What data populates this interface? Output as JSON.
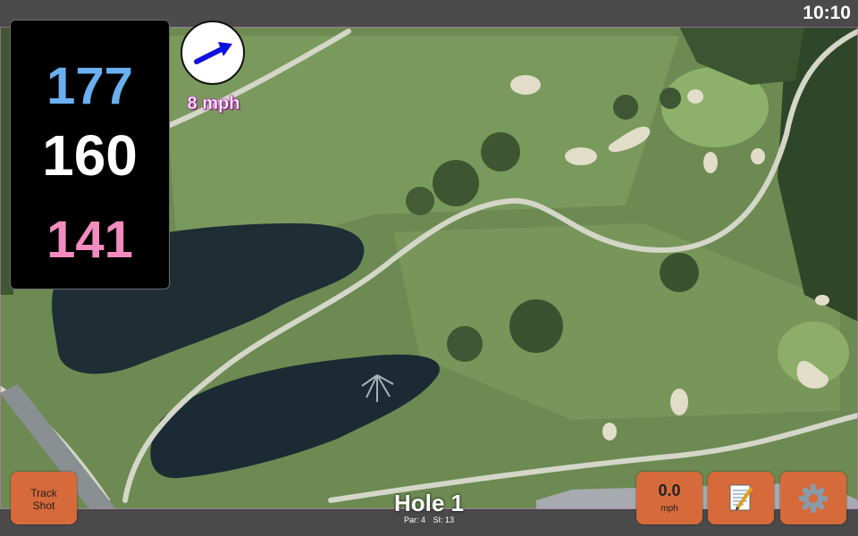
{
  "status": {
    "time": "10:10"
  },
  "distances": {
    "back": "177",
    "middle": "160",
    "front": "141"
  },
  "wind": {
    "speed_label": "8 mph",
    "icon": "wind-direction-arrow-icon"
  },
  "buttons": {
    "track_shot_line1": "Track",
    "track_shot_line2": "Shot",
    "speed_value": "0.0",
    "speed_unit": "mph",
    "notes_icon": "notepad-icon",
    "settings_icon": "gear-icon"
  },
  "hole": {
    "title": "Hole 1",
    "par": "Par: 4",
    "stroke_index": "SI: 13"
  },
  "colors": {
    "back": "#6ab0f0",
    "middle": "#ffffff",
    "front": "#f28cc0",
    "button": "#d66a3a",
    "bar": "#4a4a4a"
  }
}
